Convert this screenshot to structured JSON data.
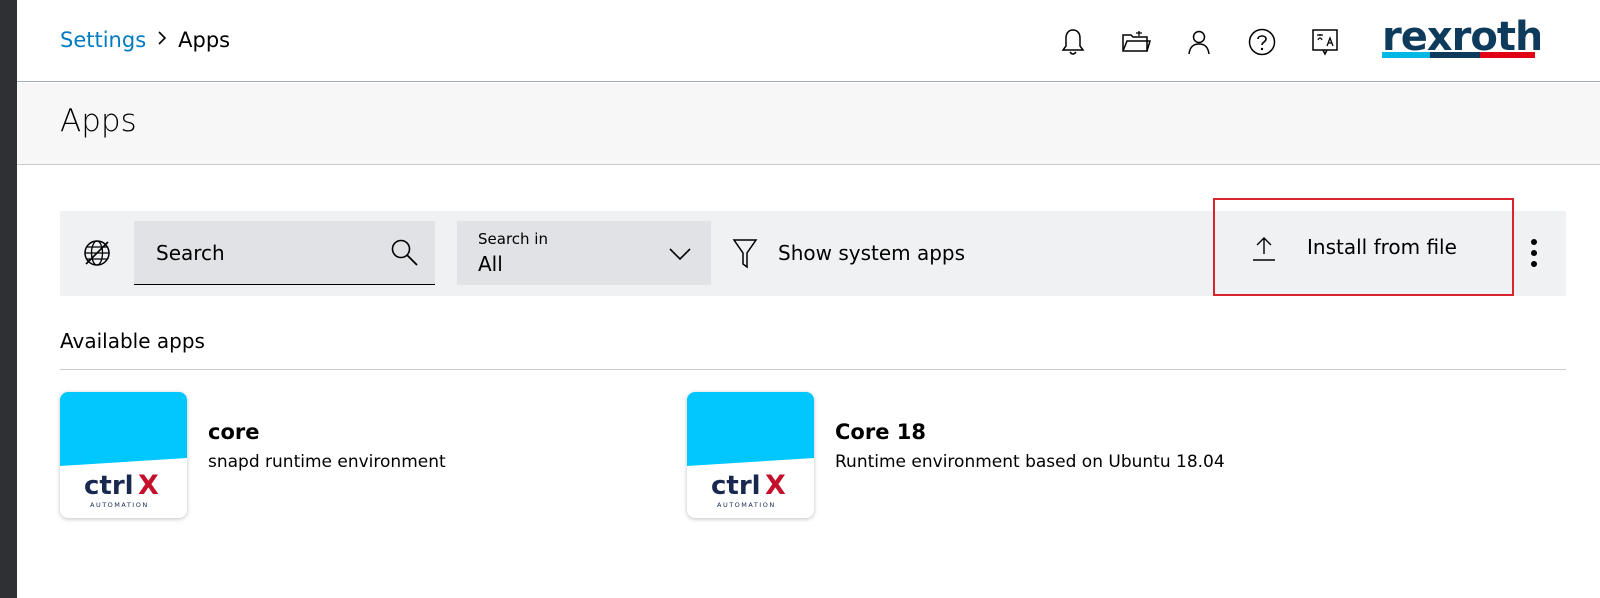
{
  "breadcrumb": {
    "parent": "Settings",
    "current": "Apps"
  },
  "header": {
    "icons": [
      "bell-icon",
      "folder-icon",
      "user-icon",
      "help-icon",
      "language-icon"
    ],
    "logo_text": "rexroth"
  },
  "page": {
    "title": "Apps"
  },
  "toolbar": {
    "search_placeholder": "Search",
    "search_in_label": "Search in",
    "search_in_value": "All",
    "show_system_apps": "Show system apps",
    "install_label": "Install from file"
  },
  "section": {
    "title": "Available apps"
  },
  "apps": [
    {
      "name": "core",
      "description": "snapd runtime environment",
      "logo_text": "ctrlX",
      "logo_sub": "AUTOMATION"
    },
    {
      "name": "Core 18",
      "description": "Runtime environment based on Ubuntu 18.04",
      "logo_text": "ctrlX",
      "logo_sub": "AUTOMATION"
    }
  ],
  "colors": {
    "link": "#007bc0",
    "highlight_border": "#d9232d",
    "tile_cyan": "#00c8ff",
    "ctrl_blue": "#18284f",
    "x_red": "#c5102b"
  }
}
